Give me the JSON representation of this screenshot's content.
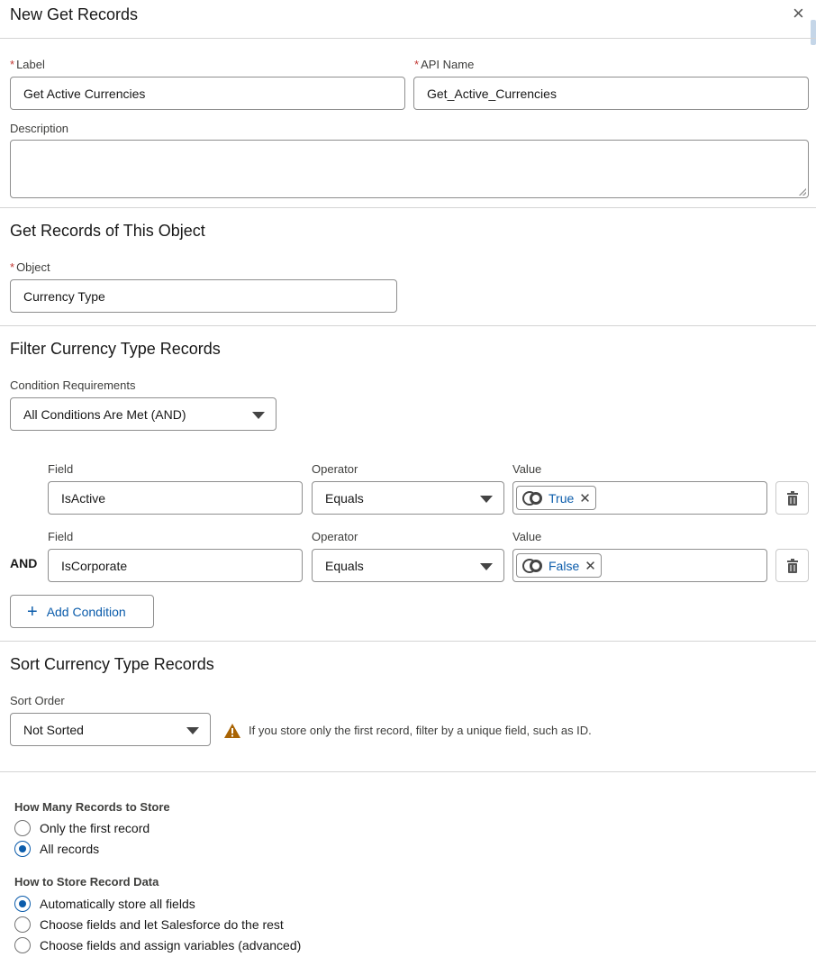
{
  "modal": {
    "title": "New Get Records",
    "close_label": "×"
  },
  "basic": {
    "label_label": "Label",
    "label_value": "Get Active Currencies",
    "api_label": "API Name",
    "api_value": "Get_Active_Currencies",
    "description_label": "Description",
    "required_marker": "*"
  },
  "object_section": {
    "title": "Get Records of This Object",
    "object_label": "Object",
    "object_value": "Currency Type"
  },
  "filter_section": {
    "title": "Filter Currency Type Records",
    "condition_label": "Condition Requirements",
    "condition_value": "All Conditions Are Met (AND)",
    "rows": [
      {
        "field_label": "Field",
        "field_value": "IsActive",
        "operator_label": "Operator",
        "operator_value": "Equals",
        "value_label": "Value",
        "value_pill": "True",
        "prefix": ""
      },
      {
        "field_label": "Field",
        "field_value": "IsCorporate",
        "operator_label": "Operator",
        "operator_value": "Equals",
        "value_label": "Value",
        "value_pill": "False",
        "prefix": "AND"
      }
    ],
    "add_condition_label": "Add Condition"
  },
  "sort_section": {
    "title": "Sort Currency Type Records",
    "sort_label": "Sort Order",
    "sort_value": "Not Sorted",
    "warning_text": "If you store only the first record, filter by a unique field, such as ID."
  },
  "store_section": {
    "how_many_label": "How Many Records to Store",
    "how_many_options": [
      {
        "label": "Only the first record",
        "checked": false
      },
      {
        "label": "All records",
        "checked": true
      }
    ],
    "how_store_label": "How to Store Record Data",
    "how_store_options": [
      {
        "label": "Automatically store all fields",
        "checked": true
      },
      {
        "label": "Choose fields and let Salesforce do the rest",
        "checked": false
      },
      {
        "label": "Choose fields and assign variables (advanced)",
        "checked": false
      }
    ]
  },
  "colors": {
    "brand": "#0b5cab",
    "required": "#c23934",
    "warning": "#a96404"
  }
}
